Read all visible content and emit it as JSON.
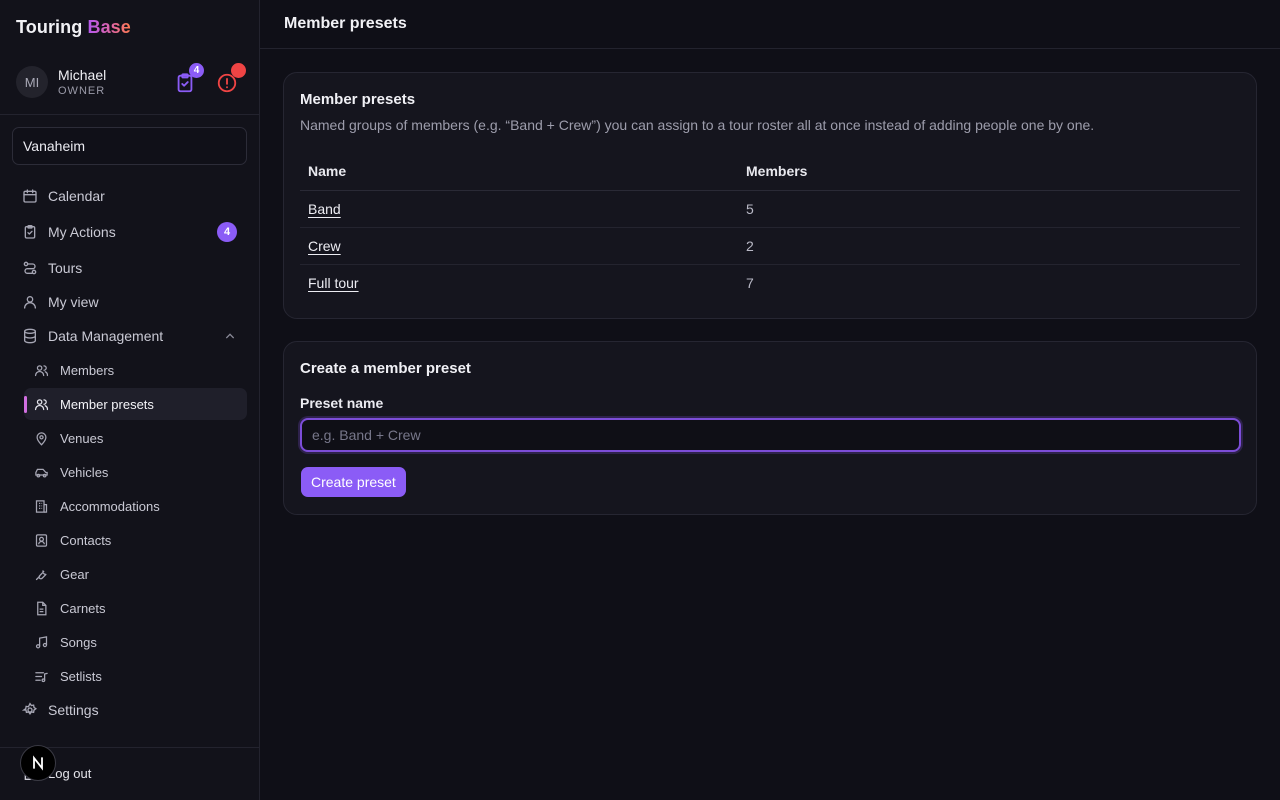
{
  "brand": {
    "part1": "Touring",
    "part2": "Base"
  },
  "user": {
    "initials": "MI",
    "name": "Michael",
    "role": "OWNER",
    "actions_count": "4"
  },
  "org": {
    "selected": "Vanaheim"
  },
  "sidebar": {
    "items": [
      {
        "label": "Calendar",
        "icon": "calendar-icon"
      },
      {
        "label": "My Actions",
        "icon": "clipboard-check-icon",
        "badge": "4"
      },
      {
        "label": "Tours",
        "icon": "route-icon"
      },
      {
        "label": "My view",
        "icon": "user-icon"
      },
      {
        "label": "Data Management",
        "icon": "database-icon",
        "expanded": true
      },
      {
        "label": "Settings",
        "icon": "gear-icon"
      }
    ],
    "sub_items": [
      {
        "label": "Members",
        "icon": "users-icon"
      },
      {
        "label": "Member presets",
        "icon": "users-icon",
        "active": true
      },
      {
        "label": "Venues",
        "icon": "map-pin-icon"
      },
      {
        "label": "Vehicles",
        "icon": "car-icon"
      },
      {
        "label": "Accommodations",
        "icon": "building-icon"
      },
      {
        "label": "Contacts",
        "icon": "contact-icon"
      },
      {
        "label": "Gear",
        "icon": "wrench-icon"
      },
      {
        "label": "Carnets",
        "icon": "file-icon"
      },
      {
        "label": "Songs",
        "icon": "music-icon"
      },
      {
        "label": "Setlists",
        "icon": "list-music-icon"
      }
    ],
    "logout_label": "Log out"
  },
  "page": {
    "title": "Member presets"
  },
  "presets_card": {
    "title": "Member presets",
    "description": "Named groups of members (e.g. “Band + Crew”) you can assign to a tour roster all at once instead of adding people one by one.",
    "columns": [
      "Name",
      "Members"
    ],
    "rows": [
      {
        "name": "Band",
        "members": "5"
      },
      {
        "name": "Crew",
        "members": "2"
      },
      {
        "name": "Full tour",
        "members": "7"
      }
    ]
  },
  "create_card": {
    "title": "Create a member preset",
    "field_label": "Preset name",
    "placeholder": "e.g. Band + Crew",
    "value": "",
    "button_label": "Create preset"
  },
  "colors": {
    "accent": "#8b5cf6",
    "alert": "#ef4444",
    "background": "#0f0f17"
  }
}
